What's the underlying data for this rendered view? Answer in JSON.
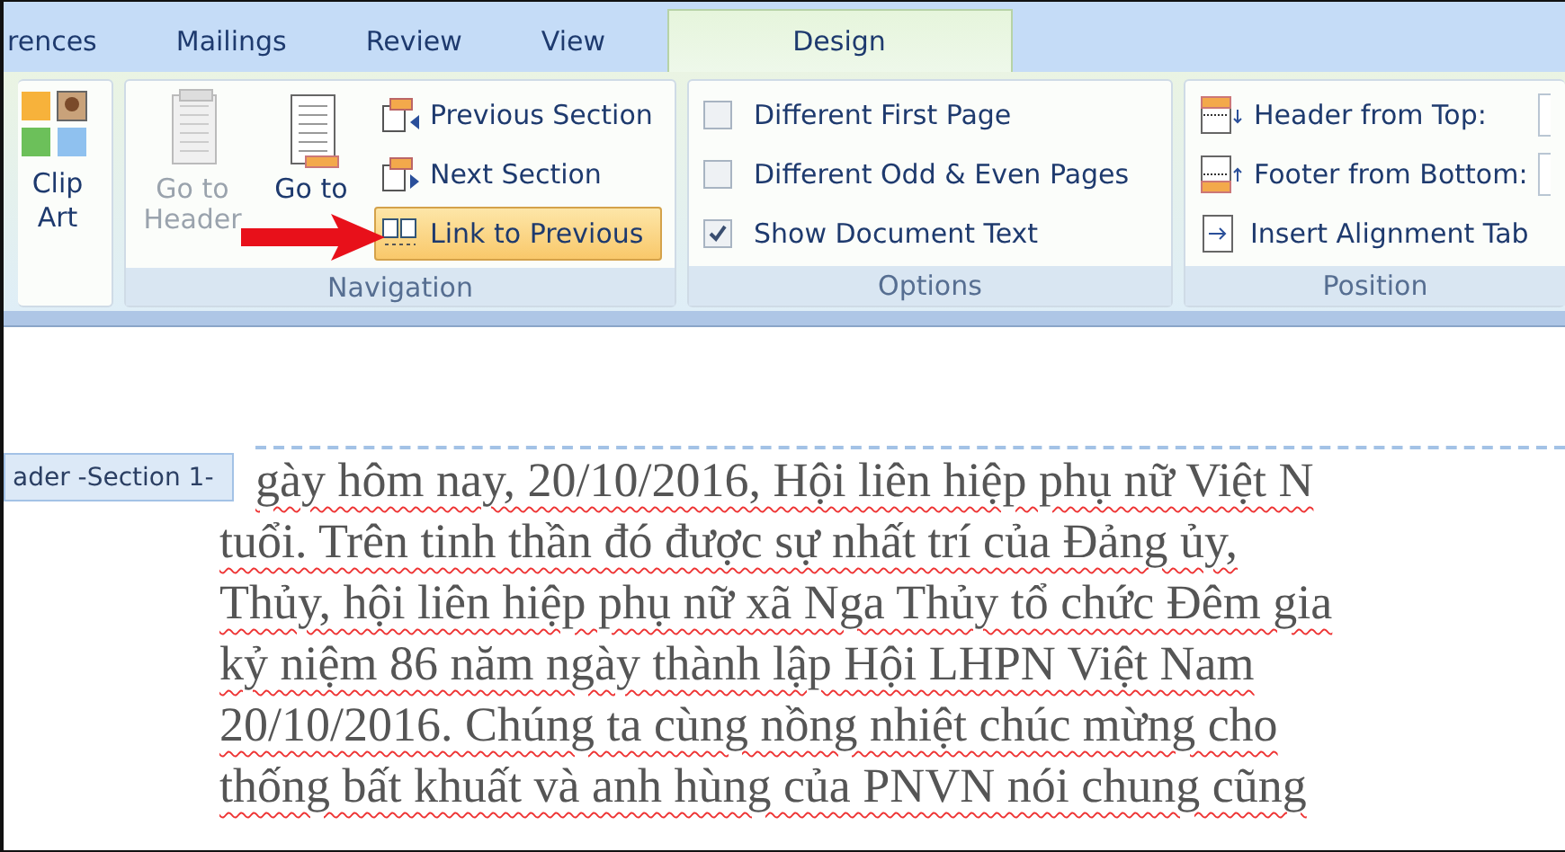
{
  "tabs": [
    {
      "label": "rences",
      "selected": false
    },
    {
      "label": "Mailings",
      "selected": false
    },
    {
      "label": "Review",
      "selected": false
    },
    {
      "label": "View",
      "selected": false
    },
    {
      "label": "Design",
      "selected": true
    }
  ],
  "ribbon": {
    "clip_art": {
      "label": "Clip Art"
    },
    "navigation": {
      "label": "Navigation",
      "large_buttons": [
        {
          "label": "Go to Header",
          "disabled": true
        },
        {
          "label": "Go to",
          "disabled": false
        }
      ],
      "small_buttons": [
        {
          "label": "Previous Section",
          "selected": false
        },
        {
          "label": "Next Section",
          "selected": false
        },
        {
          "label": "Link to Previous",
          "selected": true
        }
      ]
    },
    "options": {
      "label": "Options",
      "checkboxes": [
        {
          "label": "Different First Page",
          "checked": false
        },
        {
          "label": "Different Odd & Even Pages",
          "checked": false
        },
        {
          "label": "Show Document Text",
          "checked": true
        }
      ]
    },
    "position": {
      "label": "Position",
      "items": [
        {
          "label": "Header from Top:",
          "kind": "spin"
        },
        {
          "label": "Footer from Bottom:",
          "kind": "spin"
        },
        {
          "label": "Insert Alignment Tab",
          "kind": "button"
        }
      ]
    }
  },
  "document": {
    "header_tag": "ader -Section 1-",
    "lines": [
      "gày hôm nay, 20/10/2016, Hội liên hiệp phụ nữ Việt N",
      "tuổi. Trên tinh thần đó được sự nhất trí của Đảng ủy,",
      "Thủy, hội liên hiệp phụ nữ xã Nga Thủy tổ chức Đêm gia",
      "kỷ niệm 86 năm ngày thành lập Hội LHPN Việt Nam",
      "20/10/2016. Chúng ta cùng nồng nhiệt chúc mừng cho",
      "thống bất khuất và anh hùng của PNVN nói chung cũng"
    ]
  }
}
